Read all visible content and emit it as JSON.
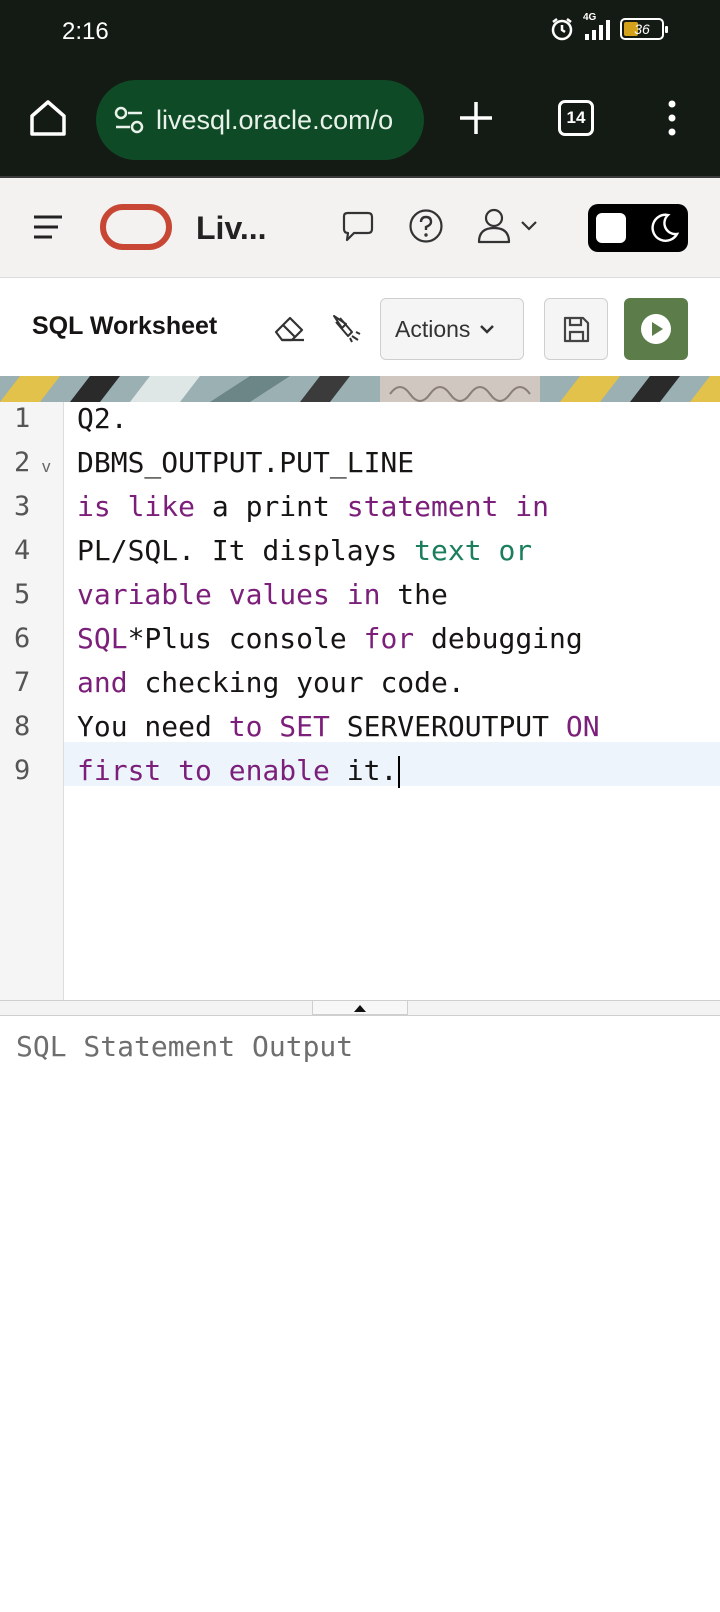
{
  "status_bar": {
    "time": "2:16",
    "network": "4G",
    "battery": "36"
  },
  "browser": {
    "url": "livesql.oracle.com/o",
    "tab_count": "14"
  },
  "app": {
    "title": "Liv..."
  },
  "worksheet": {
    "title": "SQL Worksheet",
    "actions_label": "Actions"
  },
  "editor": {
    "lines": [
      {
        "number": "1",
        "tokens": [
          {
            "t": "Q2.",
            "k": "plain"
          }
        ]
      },
      {
        "number": "2",
        "tokens": [
          {
            "t": "DBMS_OUTPUT.PUT_LINE",
            "k": "plain"
          }
        ]
      },
      {
        "number": "3",
        "tokens": [
          {
            "t": "is like",
            "k": "kw"
          },
          {
            "t": " a print ",
            "k": "plain"
          },
          {
            "t": "statement in",
            "k": "kw"
          }
        ]
      },
      {
        "number": "4",
        "tokens": [
          {
            "t": "PL/SQL. It displays ",
            "k": "plain"
          },
          {
            "t": "text or",
            "k": "str"
          }
        ]
      },
      {
        "number": "5",
        "tokens": [
          {
            "t": "variable values in",
            "k": "kw"
          },
          {
            "t": " the",
            "k": "plain"
          }
        ]
      },
      {
        "number": "6",
        "tokens": [
          {
            "t": "SQL",
            "k": "kw"
          },
          {
            "t": "*Plus console ",
            "k": "plain"
          },
          {
            "t": "for",
            "k": "kw"
          },
          {
            "t": " debugging",
            "k": "plain"
          }
        ]
      },
      {
        "number": "7",
        "tokens": [
          {
            "t": "and",
            "k": "kw"
          },
          {
            "t": " checking your code.",
            "k": "plain"
          }
        ]
      },
      {
        "number": "8",
        "tokens": [
          {
            "t": "You need ",
            "k": "plain"
          },
          {
            "t": "to SET",
            "k": "kw"
          },
          {
            "t": " SERVEROUTPUT ",
            "k": "plain"
          },
          {
            "t": "ON",
            "k": "kw"
          }
        ]
      },
      {
        "number": "9",
        "tokens": [
          {
            "t": "first to enable",
            "k": "kw"
          },
          {
            "t": " it.",
            "k": "plain"
          }
        ]
      }
    ],
    "active_line": 9
  },
  "output": {
    "placeholder": "SQL Statement Output"
  }
}
